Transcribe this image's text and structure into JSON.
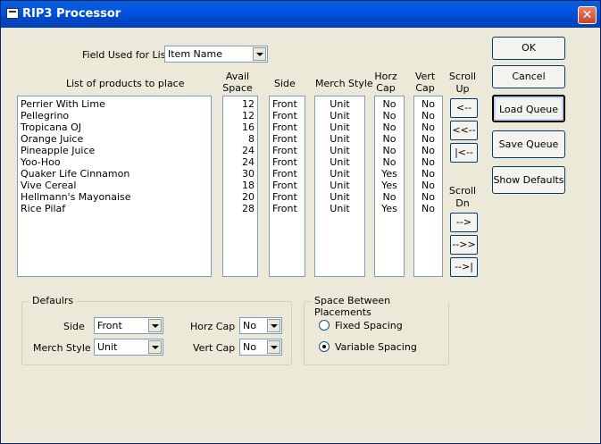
{
  "window": {
    "title": "RIP3 Processor"
  },
  "field_used": {
    "label": "Field Used for List",
    "value": "Item Name"
  },
  "columns": {
    "products": "List of products to place",
    "avail_space": "Avail Space",
    "side": "Side",
    "merch_style": "Merch Style",
    "horz_cap": "Horz Cap",
    "vert_cap": "Vert Cap",
    "scroll_up": "Scroll Up",
    "scroll_dn": "Scroll Dn"
  },
  "rows": [
    {
      "name": "Perrier With Lime",
      "space": "12",
      "side": "Front",
      "merch": "Unit",
      "horz": "No",
      "vert": "No"
    },
    {
      "name": "Pellegrino",
      "space": "12",
      "side": "Front",
      "merch": "Unit",
      "horz": "No",
      "vert": "No"
    },
    {
      "name": "Tropicana OJ",
      "space": "16",
      "side": "Front",
      "merch": "Unit",
      "horz": "No",
      "vert": "No"
    },
    {
      "name": "Orange Juice",
      "space": "8",
      "side": "Front",
      "merch": "Unit",
      "horz": "No",
      "vert": "No"
    },
    {
      "name": "Pineapple Juice",
      "space": "24",
      "side": "Front",
      "merch": "Unit",
      "horz": "No",
      "vert": "No"
    },
    {
      "name": "Yoo-Hoo",
      "space": "24",
      "side": "Front",
      "merch": "Unit",
      "horz": "No",
      "vert": "No"
    },
    {
      "name": "Quaker Life Cinnamon",
      "space": "30",
      "side": "Front",
      "merch": "Unit",
      "horz": "Yes",
      "vert": "No"
    },
    {
      "name": "Vive Cereal",
      "space": "18",
      "side": "Front",
      "merch": "Unit",
      "horz": "Yes",
      "vert": "No"
    },
    {
      "name": "Hellmann's Mayonaise",
      "space": "20",
      "side": "Front",
      "merch": "Unit",
      "horz": "No",
      "vert": "No"
    },
    {
      "name": "Rice Pilaf",
      "space": "28",
      "side": "Front",
      "merch": "Unit",
      "horz": "Yes",
      "vert": "No"
    }
  ],
  "scroll_buttons": {
    "up1": "<--",
    "up_page": "<<--",
    "up_top": "|<--",
    "dn1": "-->",
    "dn_page": "-->>",
    "dn_bottom": "-->|"
  },
  "buttons": {
    "ok": "OK",
    "cancel": "Cancel",
    "load_queue": "Load Queue",
    "save_queue": "Save Queue",
    "show_defaults": "Show Defaults"
  },
  "defaults_group": {
    "title": "Defaulrs",
    "side_label": "Side",
    "side_value": "Front",
    "merch_label": "Merch Style",
    "merch_value": "Unit",
    "horz_label": "Horz Cap",
    "horz_value": "No",
    "vert_label": "Vert Cap",
    "vert_value": "No"
  },
  "spacing_group": {
    "title": "Space Between Placements",
    "fixed": "Fixed Spacing",
    "variable": "Variable Spacing",
    "selected": "variable"
  }
}
